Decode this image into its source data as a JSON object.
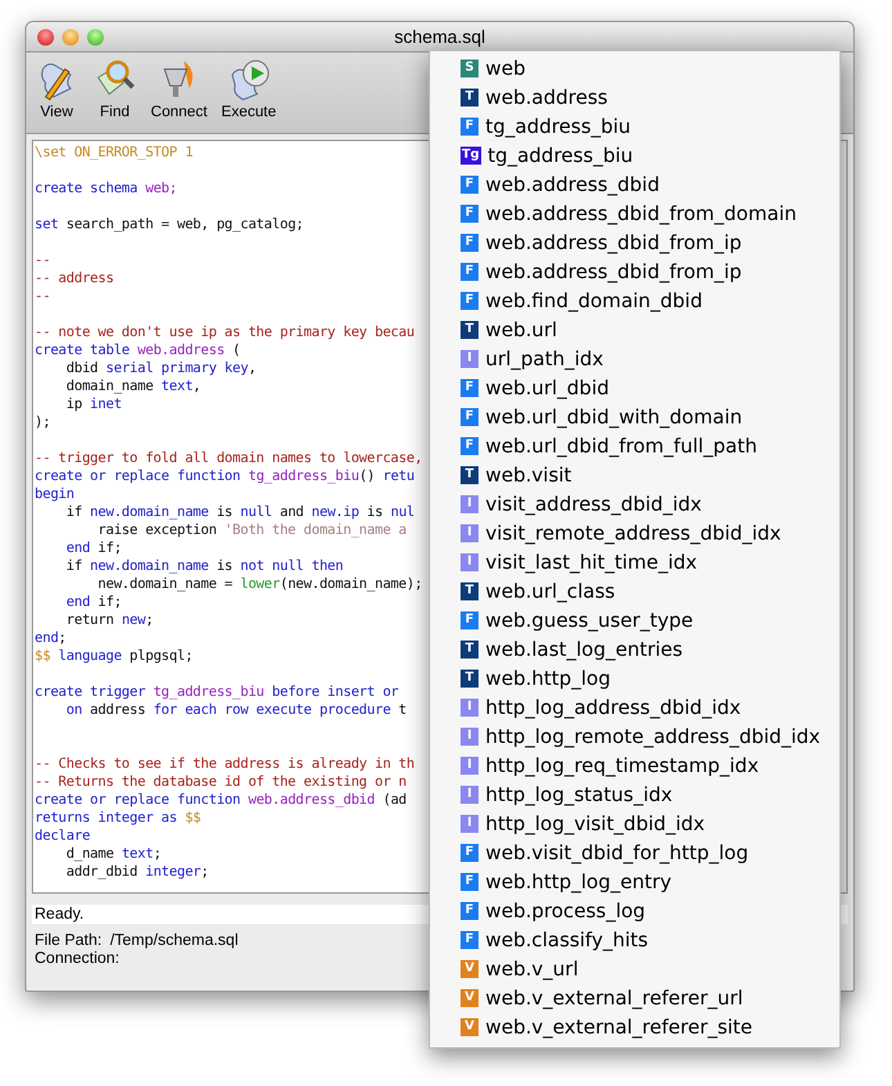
{
  "window": {
    "title": "schema.sql"
  },
  "toolbar": [
    {
      "kind": "view",
      "label": "View"
    },
    {
      "kind": "find",
      "label": "Find"
    },
    {
      "kind": "connect",
      "label": "Connect"
    },
    {
      "kind": "execute",
      "label": "Execute"
    }
  ],
  "editor": {
    "blocks": [
      {
        "lines": [
          [
            {
              "kind": "meta",
              "text": "\\set ON_ERROR_STOP 1"
            }
          ]
        ]
      },
      {
        "lines": [
          [
            {
              "kind": "keyword",
              "text": "create schema "
            },
            {
              "kind": "ident",
              "text": "web;"
            }
          ]
        ]
      },
      {
        "lines": [
          [
            {
              "kind": "keyword",
              "text": "set"
            },
            {
              "kind": "plain",
              "text": " search_path = web, pg_catalog;"
            }
          ]
        ]
      },
      {
        "lines": [
          [
            {
              "kind": "comment",
              "text": "--"
            }
          ],
          [
            {
              "kind": "comment",
              "text": "-- address"
            }
          ],
          [
            {
              "kind": "comment",
              "text": "--"
            }
          ]
        ]
      },
      {
        "lines": [
          [
            {
              "kind": "comment",
              "text": "-- note we don't use ip as the primary key becau"
            }
          ],
          [
            {
              "kind": "keyword",
              "text": "create table "
            },
            {
              "kind": "ident",
              "text": "web.address"
            },
            {
              "kind": "plain",
              "text": " ("
            }
          ],
          [
            {
              "kind": "plain",
              "text": "    dbid "
            },
            {
              "kind": "keyword",
              "text": "serial primary key"
            },
            {
              "kind": "plain",
              "text": ","
            }
          ],
          [
            {
              "kind": "plain",
              "text": "    domain_name "
            },
            {
              "kind": "keyword",
              "text": "text"
            },
            {
              "kind": "plain",
              "text": ","
            }
          ],
          [
            {
              "kind": "plain",
              "text": "    ip "
            },
            {
              "kind": "keyword",
              "text": "inet"
            }
          ],
          [
            {
              "kind": "plain",
              "text": ");"
            }
          ]
        ]
      },
      {
        "lines": [
          [
            {
              "kind": "comment",
              "text": "-- trigger to fold all domain names to lowercase,"
            }
          ],
          [
            {
              "kind": "keyword",
              "text": "create or replace function "
            },
            {
              "kind": "ident",
              "text": "tg_address_biu"
            },
            {
              "kind": "plain",
              "text": "() "
            },
            {
              "kind": "keyword",
              "text": "retu"
            }
          ],
          [
            {
              "kind": "keyword",
              "text": "begin"
            }
          ],
          [
            {
              "kind": "plain",
              "text": "    if "
            },
            {
              "kind": "keyword",
              "text": "new.domain_name"
            },
            {
              "kind": "plain",
              "text": " is "
            },
            {
              "kind": "keyword",
              "text": "null"
            },
            {
              "kind": "plain",
              "text": " and "
            },
            {
              "kind": "keyword",
              "text": "new.ip"
            },
            {
              "kind": "plain",
              "text": " is "
            },
            {
              "kind": "keyword",
              "text": "nul"
            }
          ],
          [
            {
              "kind": "plain",
              "text": "        raise exception "
            },
            {
              "kind": "string",
              "text": "'Both the domain_name a"
            }
          ],
          [
            {
              "kind": "keyword",
              "text": "    end"
            },
            {
              "kind": "plain",
              "text": " if;"
            }
          ],
          [
            {
              "kind": "plain",
              "text": "    if "
            },
            {
              "kind": "keyword",
              "text": "new.domain_name"
            },
            {
              "kind": "plain",
              "text": " is "
            },
            {
              "kind": "keyword",
              "text": "not null then"
            }
          ],
          [
            {
              "kind": "plain",
              "text": "        new.domain_name = "
            },
            {
              "kind": "func",
              "text": "lower"
            },
            {
              "kind": "plain",
              "text": "(new.domain_name);"
            }
          ],
          [
            {
              "kind": "keyword",
              "text": "    end"
            },
            {
              "kind": "plain",
              "text": " if;"
            }
          ],
          [
            {
              "kind": "plain",
              "text": "    return "
            },
            {
              "kind": "keyword",
              "text": "new"
            },
            {
              "kind": "plain",
              "text": ";"
            }
          ],
          [
            {
              "kind": "keyword",
              "text": "end"
            },
            {
              "kind": "plain",
              "text": ";"
            }
          ],
          [
            {
              "kind": "meta",
              "text": "$$"
            },
            {
              "kind": "keyword",
              "text": " language"
            },
            {
              "kind": "plain",
              "text": " plpgsql;"
            }
          ]
        ]
      },
      {
        "lines": [
          [
            {
              "kind": "keyword",
              "text": "create trigger "
            },
            {
              "kind": "ident",
              "text": "tg_address_biu"
            },
            {
              "kind": "keyword",
              "text": " before insert or"
            }
          ],
          [
            {
              "kind": "keyword",
              "text": "    on "
            },
            {
              "kind": "plain",
              "text": "address"
            },
            {
              "kind": "keyword",
              "text": " for each row execute procedure "
            },
            {
              "kind": "plain",
              "text": "t"
            }
          ]
        ]
      },
      {
        "lines": [
          [
            {
              "kind": "comment",
              "text": "-- Checks to see if the address is already in th"
            }
          ],
          [
            {
              "kind": "comment",
              "text": "-- Returns the database id of the existing or n"
            }
          ],
          [
            {
              "kind": "keyword",
              "text": "create or replace function "
            },
            {
              "kind": "ident",
              "text": "web.address_dbid"
            },
            {
              "kind": "plain",
              "text": " (ad"
            }
          ],
          [
            {
              "kind": "keyword",
              "text": "returns integer as "
            },
            {
              "kind": "meta",
              "text": "$$"
            }
          ],
          [
            {
              "kind": "keyword",
              "text": "declare"
            }
          ],
          [
            {
              "kind": "plain",
              "text": "    d_name "
            },
            {
              "kind": "keyword",
              "text": "text"
            },
            {
              "kind": "plain",
              "text": ";"
            }
          ],
          [
            {
              "kind": "plain",
              "text": "    addr_dbid "
            },
            {
              "kind": "keyword",
              "text": "integer"
            },
            {
              "kind": "plain",
              "text": ";"
            }
          ]
        ]
      }
    ]
  },
  "status": "Ready.",
  "info": [
    {
      "label": "File Path:",
      "value": "/Temp/schema.sql"
    },
    {
      "label": "Connection:"
    }
  ],
  "popup": {
    "items": [
      {
        "kind": "schema",
        "badge": "S",
        "name": "web"
      },
      {
        "kind": "table",
        "badge": "T",
        "name": "web.address"
      },
      {
        "kind": "function",
        "badge": "F",
        "name": "tg_address_biu"
      },
      {
        "kind": "trigger",
        "badge": "Tg",
        "name": "tg_address_biu"
      },
      {
        "kind": "function",
        "badge": "F",
        "name": "web.address_dbid"
      },
      {
        "kind": "function",
        "badge": "F",
        "name": "web.address_dbid_from_domain"
      },
      {
        "kind": "function",
        "badge": "F",
        "name": "web.address_dbid_from_ip"
      },
      {
        "kind": "function",
        "badge": "F",
        "name": "web.address_dbid_from_ip"
      },
      {
        "kind": "function",
        "badge": "F",
        "name": "web.find_domain_dbid"
      },
      {
        "kind": "table",
        "badge": "T",
        "name": "web.url"
      },
      {
        "kind": "index",
        "badge": "I",
        "name": "url_path_idx"
      },
      {
        "kind": "function",
        "badge": "F",
        "name": "web.url_dbid"
      },
      {
        "kind": "function",
        "badge": "F",
        "name": "web.url_dbid_with_domain"
      },
      {
        "kind": "function",
        "badge": "F",
        "name": "web.url_dbid_from_full_path"
      },
      {
        "kind": "table",
        "badge": "T",
        "name": "web.visit"
      },
      {
        "kind": "index",
        "badge": "I",
        "name": "visit_address_dbid_idx"
      },
      {
        "kind": "index",
        "badge": "I",
        "name": "visit_remote_address_dbid_idx"
      },
      {
        "kind": "index",
        "badge": "I",
        "name": "visit_last_hit_time_idx"
      },
      {
        "kind": "table",
        "badge": "T",
        "name": "web.url_class"
      },
      {
        "kind": "function",
        "badge": "F",
        "name": "web.guess_user_type"
      },
      {
        "kind": "table",
        "badge": "T",
        "name": "web.last_log_entries"
      },
      {
        "kind": "table",
        "badge": "T",
        "name": "web.http_log"
      },
      {
        "kind": "index",
        "badge": "I",
        "name": "http_log_address_dbid_idx"
      },
      {
        "kind": "index",
        "badge": "I",
        "name": "http_log_remote_address_dbid_idx"
      },
      {
        "kind": "index",
        "badge": "I",
        "name": "http_log_req_timestamp_idx"
      },
      {
        "kind": "index",
        "badge": "I",
        "name": "http_log_status_idx"
      },
      {
        "kind": "index",
        "badge": "I",
        "name": "http_log_visit_dbid_idx"
      },
      {
        "kind": "function",
        "badge": "F",
        "name": "web.visit_dbid_for_http_log"
      },
      {
        "kind": "function",
        "badge": "F",
        "name": "web.http_log_entry"
      },
      {
        "kind": "function",
        "badge": "F",
        "name": "web.process_log"
      },
      {
        "kind": "function",
        "badge": "F",
        "name": "web.classify_hits"
      },
      {
        "kind": "view",
        "badge": "V",
        "name": "web.v_url"
      },
      {
        "kind": "view",
        "badge": "V",
        "name": "web.v_external_referer_url"
      },
      {
        "kind": "view",
        "badge": "V",
        "name": "web.v_external_referer_site"
      }
    ]
  }
}
